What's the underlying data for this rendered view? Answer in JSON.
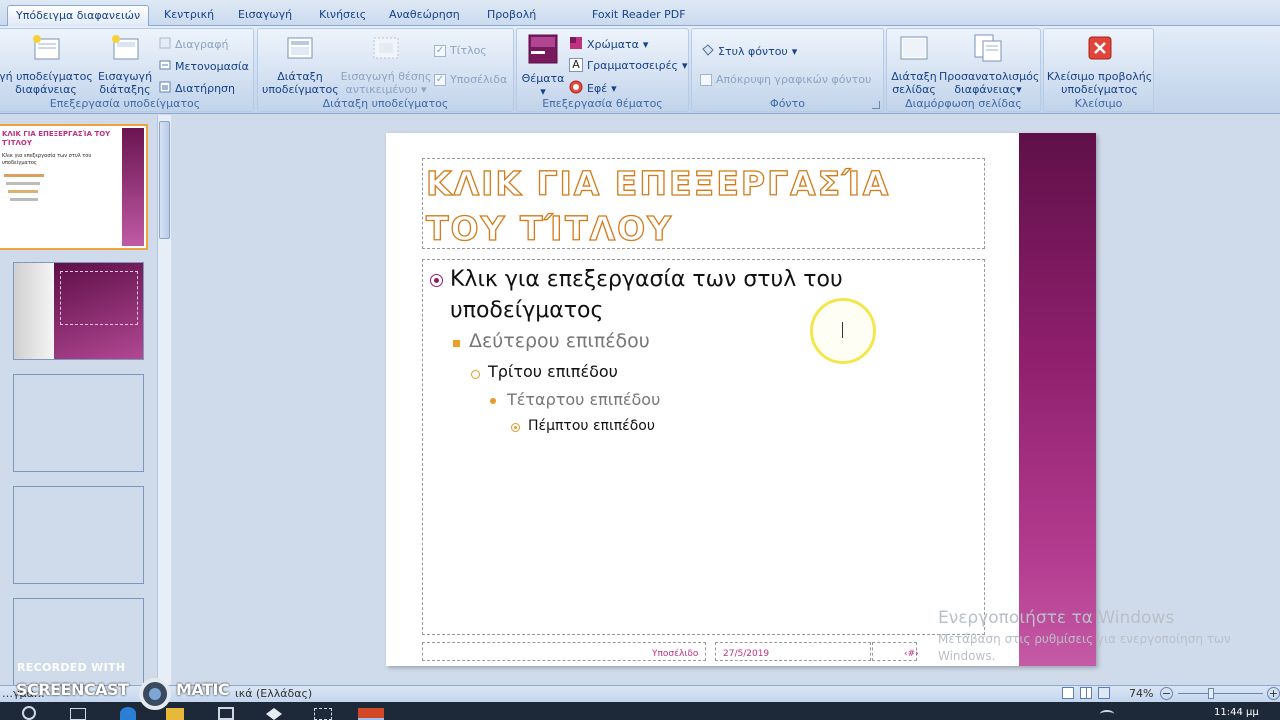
{
  "tabs": [
    "Υπόδειγμα διαφανειών",
    "Κεντρική",
    "Εισαγωγή",
    "Κινήσεις",
    "Αναθεώρηση",
    "Προβολή",
    "Foxit Reader PDF"
  ],
  "ribbon": {
    "edit_master": {
      "insert_master": "…γή υποδείγματος διαφάνειας",
      "insert_master_l1": "γή υποδείγματος",
      "insert_master_l2": "διαφάνειας",
      "insert_layout_l1": "Εισαγωγή",
      "insert_layout_l2": "διάταξης",
      "delete": "Διαγραφή",
      "rename": "Μετονομασία",
      "preserve": "Διατήρηση",
      "label": "Επεξεργασία υποδείγματος"
    },
    "master_layout": {
      "layout_l1": "Διάταξη",
      "layout_l2": "υποδείγματος",
      "insert_ph_l1": "Εισαγωγή θέσης",
      "insert_ph_l2": "αντικειμένου",
      "title_chk": "Τίτλος",
      "footers_chk": "Υποσέλιδα",
      "label": "Διάταξη υποδείγματος"
    },
    "theme": {
      "themes": "Θέματα",
      "colors": "Χρώματα",
      "fonts": "Γραμματοσειρές",
      "effects": "Εφέ",
      "label": "Επεξεργασία θέματος"
    },
    "background": {
      "styles": "Στυλ φόντου",
      "hide": "Απόκρυψη γραφικών φόντου",
      "label": "Φόντο"
    },
    "page_setup": {
      "setup_l1": "Διάταξη",
      "setup_l2": "σελίδας",
      "orient_l1": "Προσανατολισμός",
      "orient_l2": "διαφάνειας",
      "label": "Διαμόρφωση σελίδας"
    },
    "close": {
      "close_l1": "Κλείσιμο προβολής",
      "close_l2": "υποδείγματος",
      "label": "Κλείσιμο"
    }
  },
  "thumb1": {
    "title": "ΚΛΙΚ ΓΙΑ ΕΠΕΞΕΡΓΑΣΊΑ ΤΟΥ ΤΊΤΛΟΥ",
    "body": "Κλικ για επεξεργασία των στυλ του υποδείγματος"
  },
  "slide": {
    "title": "ΚΛΙΚ ΓΙΑ ΕΠΕΞΕΡΓΑΣΊΑ ΤΟΥ ΤΊΤΛΟΥ",
    "level1": "Κλικ για επεξεργασία των στυλ του υποδείγματος",
    "level1_a": "Κλικ για επεξεργασία των στυλ του",
    "level1_b": "υποδείγματος",
    "level2": "Δεύτερου επιπέδου",
    "level3": "Τρίτου επιπέδου",
    "level4": "Τέταρτου επιπέδου",
    "level5": "Πέμπτου επιπέδου",
    "footer": "Υποσέλιδο",
    "date": "27/5/2019",
    "number": "‹#›"
  },
  "watermark": {
    "line1": "Ενεργοποιήστε τα Windows",
    "line2": "Μετάβαση στις ρυθμίσεις για ενεργοποίηση των",
    "line3": "Windows."
  },
  "recorder": {
    "line1": "RECORDED WITH",
    "line2": "SCREENCAST",
    "line3": "MATIC"
  },
  "status": {
    "left": "…γμα…",
    "language": "ικά (Ελλάδας)",
    "zoom": "74%"
  },
  "clock": "11:44 μμ",
  "colors": {
    "accent_orange": "#d47b1a",
    "magenta": "#8d1e6c",
    "ribbon_text": "#15428b"
  }
}
